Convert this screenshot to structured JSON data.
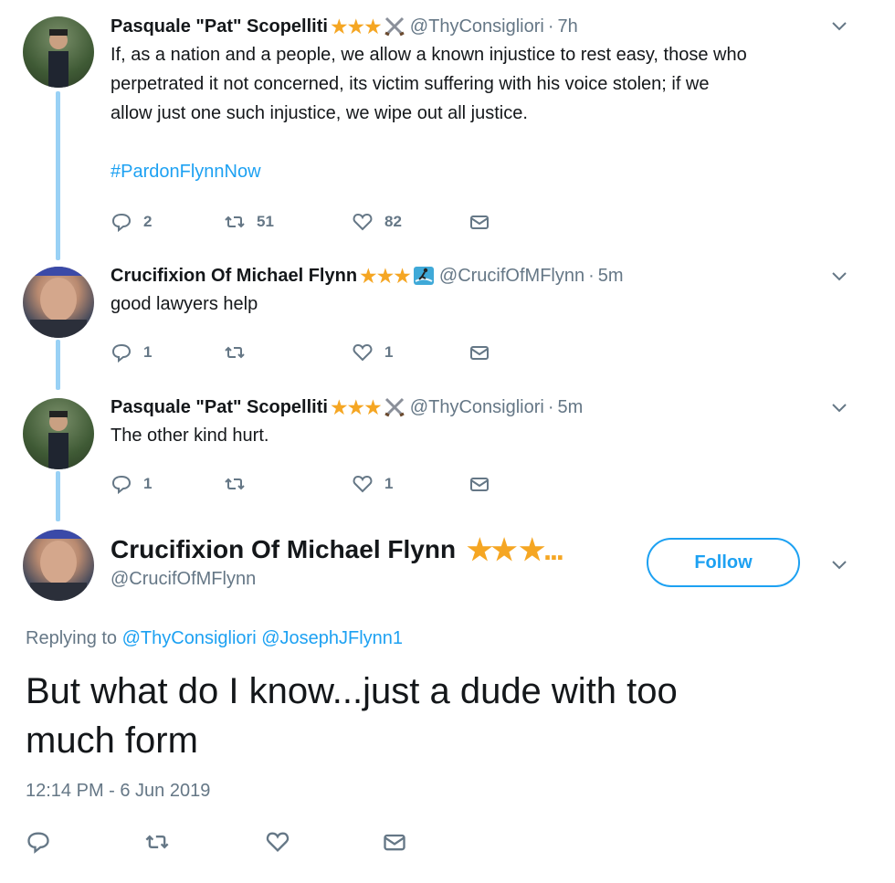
{
  "tweets": [
    {
      "name": "Pasquale \"Pat\" Scopelliti",
      "stars": "★★★",
      "emoji": "crossed-swords",
      "handle": "@ThyConsigliori",
      "sep": "·",
      "time": "7h",
      "lines": [
        "If, as a nation and a people, we allow a known injustice to rest easy, those who",
        "perpetrated it not concerned, its victim suffering with his voice stolen; if we",
        "allow just one such injustice, we wipe out all justice."
      ],
      "hashtag": "#PardonFlynnNow",
      "replies": "2",
      "retweets": "51",
      "likes": "82"
    },
    {
      "name": "Crucifixion Of Michael Flynn",
      "stars": "★★★",
      "emoji": "surfer",
      "handle": "@CrucifOfMFlynn",
      "sep": "·",
      "time": "5m",
      "text": "good lawyers help",
      "replies": "1",
      "retweets": "",
      "likes": "1"
    },
    {
      "name": "Pasquale \"Pat\" Scopelliti",
      "stars": "★★★",
      "emoji": "crossed-swords",
      "handle": "@ThyConsigliori",
      "sep": "·",
      "time": "5m",
      "text": "The other kind hurt.",
      "replies": "1",
      "retweets": "",
      "likes": "1"
    }
  ],
  "main": {
    "name": "Crucifixion Of Michael Flynn",
    "stars": "★★",
    "stars_truncated": "★...",
    "handle": "@CrucifOfMFlynn",
    "follow_label": "Follow",
    "replying_prefix": "Replying to",
    "mention_1": "@ThyConsigliori",
    "mention_2": "@JosephJFlynn1",
    "text_line1": "But what do I know...just a dude with too",
    "text_line2": "much form",
    "timestamp": "12:14 PM - 6 Jun 2019"
  },
  "colors": {
    "accent": "#1da1f2",
    "muted": "#657786",
    "star": "#f5a623",
    "thread_line": "#99d1f5"
  }
}
